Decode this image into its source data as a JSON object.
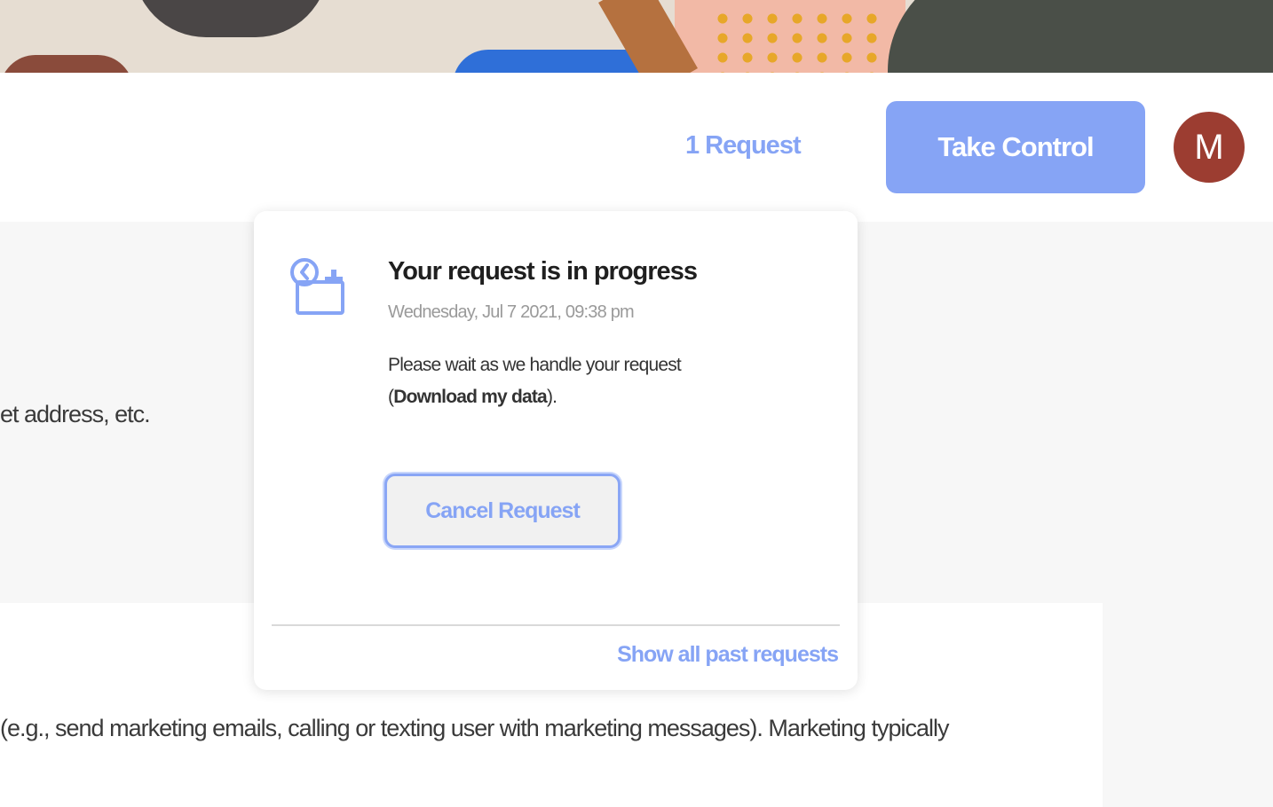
{
  "header": {
    "requests_link": "1 Request",
    "take_control_label": "Take Control",
    "avatar_initial": "M"
  },
  "background": {
    "text_line_1": "et address, etc.",
    "text_line_2": "(e.g., send marketing emails, calling or texting user with marketing messages). Marketing typically"
  },
  "popover": {
    "title": "Your request is in progress",
    "date": "Wednesday, Jul 7 2021, 09:38 pm",
    "message_prefix": "Please wait as we handle your request (",
    "message_bold": "Download my data",
    "message_suffix": ").",
    "cancel_label": "Cancel Request",
    "show_past_label": "Show all past requests",
    "icon": "clock-calendar-icon"
  },
  "colors": {
    "accent": "#86a4f5",
    "avatar_bg": "#9c3d31"
  }
}
